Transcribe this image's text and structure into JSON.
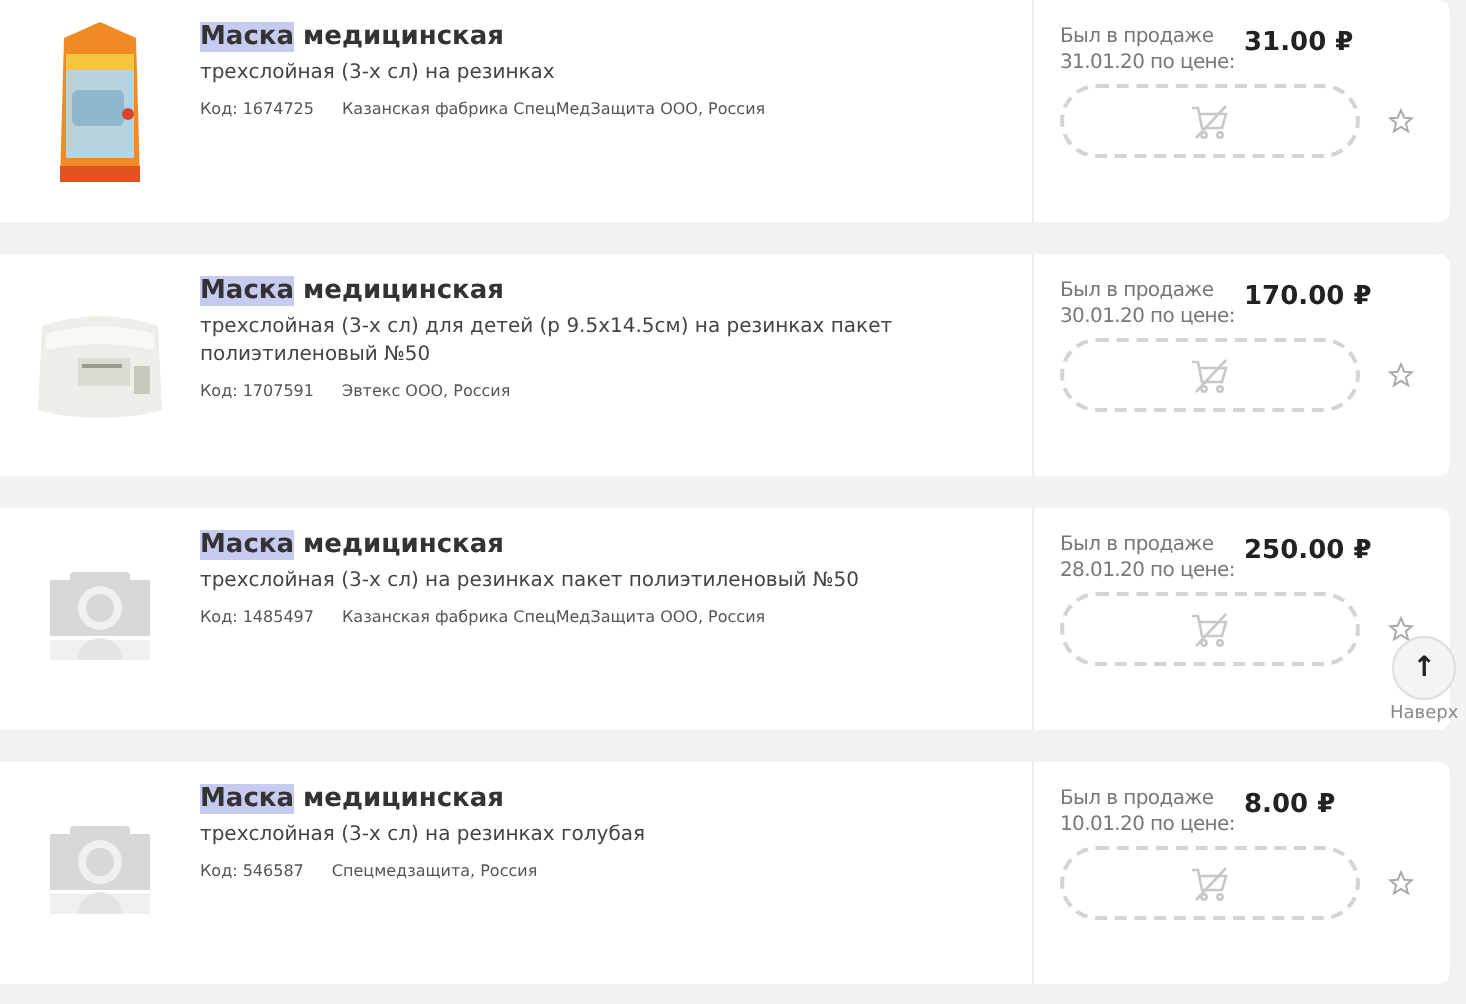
{
  "products": [
    {
      "kind": "orange-pack",
      "title_match": "Маска",
      "title_rest": "медицинская",
      "description": "трехслойная (3-х сл) на резинках",
      "code": "Код: 1674725",
      "maker": "Казанская фабрика СпецМедЗащита ООО, Россия",
      "availability": "Был в продаже 31.01.20 по цене:",
      "price": "31.00 ₽"
    },
    {
      "kind": "white-pack",
      "title_match": "Маска",
      "title_rest": "медицинская",
      "description": "трехслойная (3-х сл) для детей (р 9.5х14.5см) на резинках пакет полиэтиленовый №50",
      "code": "Код: 1707591",
      "maker": "Эвтекс ООО, Россия",
      "availability": "Был в продаже 30.01.20 по цене:",
      "price": "170.00 ₽"
    },
    {
      "kind": "placeholder",
      "title_match": "Маска",
      "title_rest": "медицинская",
      "description": "трехслойная (3-х сл) на резинках пакет полиэтиленовый №50",
      "code": "Код: 1485497",
      "maker": "Казанская фабрика СпецМедЗащита ООО, Россия",
      "availability": "Был в продаже 28.01.20 по цене:",
      "price": "250.00 ₽"
    },
    {
      "kind": "placeholder",
      "title_match": "Маска",
      "title_rest": "медицинская",
      "description": "трехслойная (3-х сл) на резинках голубая",
      "code": "Код: 546587",
      "maker": "Спецмедзащита, Россия",
      "availability": "Был в продаже 10.01.20 по цене:",
      "price": "8.00 ₽"
    }
  ],
  "back_to_top": {
    "arrow": "↑",
    "label": "Наверх"
  }
}
